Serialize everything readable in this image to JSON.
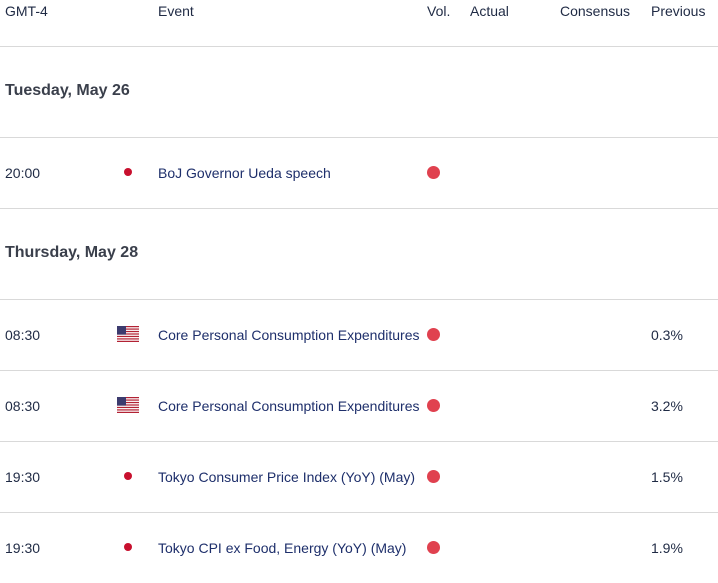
{
  "header": {
    "timezone": "GMT-4",
    "event": "Event",
    "vol": "Vol.",
    "actual": "Actual",
    "consensus": "Consensus",
    "previous": "Previous"
  },
  "days": [
    {
      "label": "Tuesday, May 26",
      "events": [
        {
          "time": "20:00",
          "country": "jp-flag-icon",
          "event": "BoJ Governor Ueda speech",
          "volatility": "high",
          "actual": "",
          "consensus": "",
          "previous": ""
        }
      ]
    },
    {
      "label": "Thursday, May 28",
      "events": [
        {
          "time": "08:30",
          "country": "us-flag-icon",
          "event": "Core Personal Consumption Expenditures",
          "volatility": "high",
          "actual": "",
          "consensus": "",
          "previous": "0.3%"
        },
        {
          "time": "08:30",
          "country": "us-flag-icon",
          "event": "Core Personal Consumption Expenditures",
          "volatility": "high",
          "actual": "",
          "consensus": "",
          "previous": "3.2%"
        },
        {
          "time": "19:30",
          "country": "jp-flag-icon",
          "event": "Tokyo Consumer Price Index (YoY) (May)",
          "volatility": "high",
          "actual": "",
          "consensus": "",
          "previous": "1.5%"
        },
        {
          "time": "19:30",
          "country": "jp-flag-icon",
          "event": "Tokyo CPI ex Food, Energy (YoY) (May)",
          "volatility": "high",
          "actual": "",
          "consensus": "",
          "previous": "1.9%"
        }
      ]
    }
  ],
  "colors": {
    "volatility_high": "#e0414f",
    "event_link": "#1e2f6b",
    "divider": "#d9d9d9"
  }
}
